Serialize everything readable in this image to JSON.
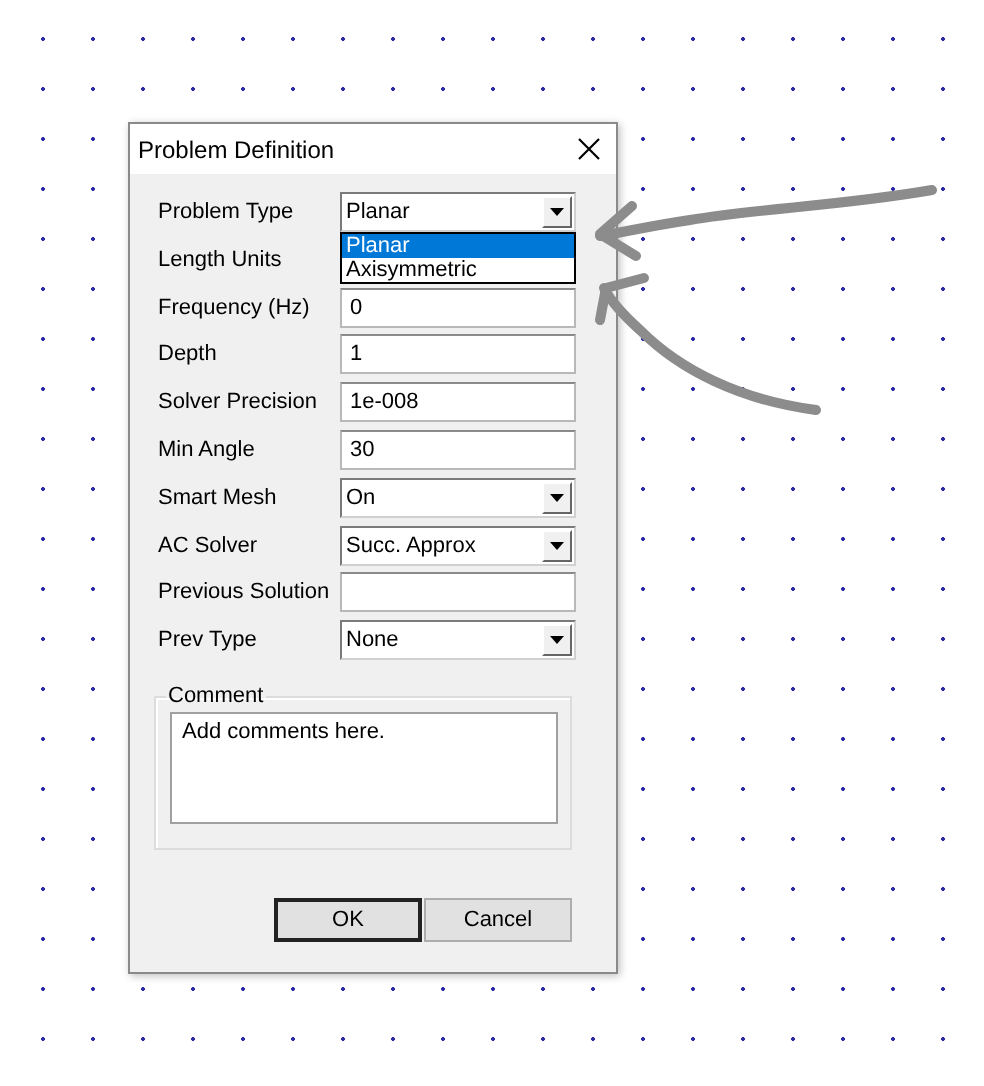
{
  "window": {
    "title": "Problem Definition"
  },
  "fields": [
    {
      "label": "Problem Type",
      "kind": "dropdown",
      "value": "Planar",
      "expanded": true,
      "options": [
        {
          "label": "Planar",
          "selected": true
        },
        {
          "label": "Axisymmetric",
          "selected": false
        }
      ]
    },
    {
      "label": "Length Units",
      "kind": "hidden"
    },
    {
      "label": "Frequency (Hz)",
      "kind": "text",
      "value": "0"
    },
    {
      "label": "Depth",
      "kind": "text",
      "value": "1"
    },
    {
      "label": "Solver Precision",
      "kind": "text",
      "value": "1e-008"
    },
    {
      "label": "Min Angle",
      "kind": "text",
      "value": "30"
    },
    {
      "label": "Smart Mesh",
      "kind": "dropdown",
      "value": "On"
    },
    {
      "label": "AC Solver",
      "kind": "dropdown",
      "value": "Succ. Approx"
    },
    {
      "label": "Previous Solution",
      "kind": "text"
    },
    {
      "label": "Prev Type",
      "kind": "dropdown",
      "value": "None"
    }
  ],
  "comment": {
    "label": "Comment",
    "value": "Add comments here."
  },
  "buttons": [
    {
      "label": "OK",
      "default": true
    },
    {
      "label": "Cancel",
      "default": false
    }
  ]
}
